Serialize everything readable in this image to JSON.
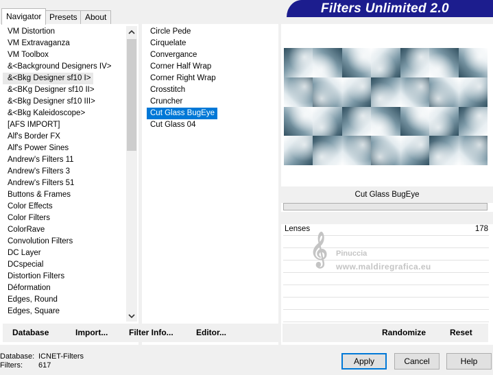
{
  "tabs": [
    "Navigator",
    "Presets",
    "About"
  ],
  "banner_title": "Filters Unlimited 2.0",
  "categories": [
    "VM Distortion",
    "VM Extravaganza",
    "VM Toolbox",
    "&<Background Designers IV>",
    "&<Bkg Designer sf10 I>",
    "&<BKg Designer sf10 II>",
    "&<Bkg Designer sf10 III>",
    "&<Bkg Kaleidoscope>",
    "[AFS IMPORT]",
    "Alf's Border FX",
    "Alf's Power Sines",
    "Andrew's Filters 11",
    "Andrew's Filters 3",
    "Andrew's Filters 51",
    "Buttons & Frames",
    "Color Effects",
    "Color Filters",
    "ColorRave",
    "Convolution Filters",
    "DC Layer",
    "DCspecial",
    "Distortion Filters",
    "Déformation",
    "Edges, Round",
    "Edges, Square"
  ],
  "filters": [
    "Circle Pede",
    "Cirquelate",
    "Convergance",
    "Corner Half Wrap",
    "Corner Right Wrap",
    "Crosstitch",
    "Cruncher",
    "Cut Glass  BugEye",
    "Cut Glass 04"
  ],
  "selected_filter_name": "Cut Glass  BugEye",
  "param": {
    "label": "Lenses",
    "value": "178"
  },
  "watermark": {
    "name": "Pinuccia",
    "site": "www.maldiregrafica.eu"
  },
  "toolbar": {
    "database": "Database",
    "import": "Import...",
    "filter_info": "Filter Info...",
    "editor": "Editor...",
    "randomize": "Randomize",
    "reset": "Reset"
  },
  "status": {
    "database_label": "Database:",
    "database_value": "ICNET-Filters",
    "filters_label": "Filters:",
    "filters_value": "617"
  },
  "buttons": {
    "apply": "Apply",
    "cancel": "Cancel",
    "help": "Help"
  },
  "icons": {
    "scroll_up": "scroll-up-arrow-icon",
    "scroll_down": "scroll-down-arrow-icon",
    "watermark": "clef-logo-icon"
  }
}
